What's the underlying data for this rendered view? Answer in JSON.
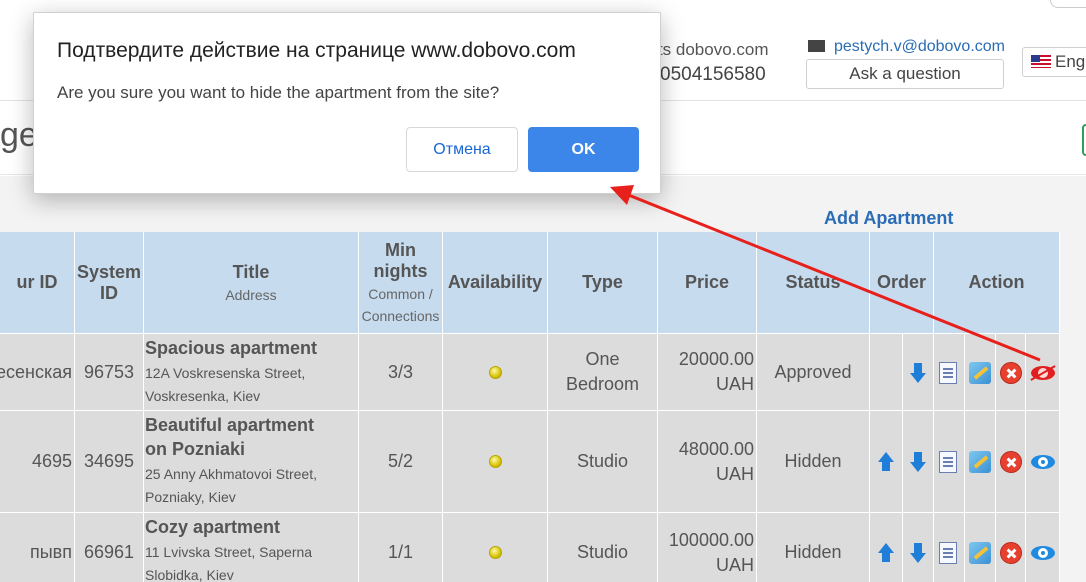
{
  "header": {
    "contacts_label": "acts dobovo.com",
    "phone": "0504156580",
    "email": "pestych.v@dobovo.com",
    "ask_button": "Ask a question",
    "language": "Eng"
  },
  "page": {
    "title_fragment": "ge",
    "add_apartment_link": "Add Apartment"
  },
  "table": {
    "headers": {
      "your_id": "ur ID",
      "system_id_1": "System",
      "system_id_2": "ID",
      "title": "Title",
      "title_sub": "Address",
      "min_nights_1": "Min",
      "min_nights_2": "nights",
      "min_nights_sub_1": "Common /",
      "min_nights_sub_2": "Connections",
      "availability": "Availability",
      "type": "Type",
      "price": "Price",
      "status": "Status",
      "order": "Order",
      "action": "Action"
    },
    "rows": [
      {
        "your_id": "есенская",
        "system_id": "96753",
        "title": "Spacious apartment",
        "address_1": "12A Voskresenska Street,",
        "address_2": "Voskresenka, Kiev",
        "min_nights": "3/3",
        "type_1": "One",
        "type_2": "Bedroom",
        "price_1": "20000.00",
        "price_2": "UAH",
        "status": "Approved"
      },
      {
        "your_id": "4695",
        "system_id": "34695",
        "title_1": "Beautiful apartment",
        "title_2": "on Pozniaki",
        "address_1": "25 Anny Akhmatovoi Street,",
        "address_2": "Pozniaky, Kiev",
        "min_nights": "5/2",
        "type": "Studio",
        "price_1": "48000.00",
        "price_2": "UAH",
        "status": "Hidden"
      },
      {
        "your_id": "пывп",
        "system_id": "66961",
        "title": "Cozy apartment",
        "address_1": "11 Lvivska Street, Saperna",
        "address_2": "Slobidka, Kiev",
        "min_nights": "1/1",
        "type": "Studio",
        "price_1": "100000.00",
        "price_2": "UAH",
        "status": "Hidden"
      }
    ]
  },
  "dialog": {
    "title": "Подтвердите действие на странице www.dobovo.com",
    "message": "Are you sure you want to hide the apartment from the site?",
    "cancel_label": "Отмена",
    "ok_label": "OK"
  },
  "icons": {
    "move_up": "arrow-up-icon",
    "move_down": "arrow-down-icon",
    "view": "document-icon",
    "edit": "edit-icon",
    "delete": "delete-icon",
    "show": "eye-icon",
    "hide": "eye-hide-icon"
  },
  "colors": {
    "link": "#2a6cb5",
    "table_header": "#c6dbee",
    "row_bg": "#dcdcdc",
    "ok_button": "#3b86e8",
    "annotation_arrow": "#e8201c"
  }
}
